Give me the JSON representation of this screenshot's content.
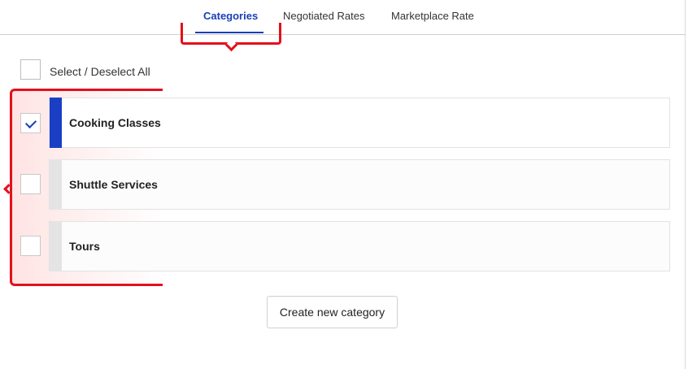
{
  "tabs": [
    {
      "label": "Categories",
      "active": true
    },
    {
      "label": "Negotiated Rates",
      "active": false
    },
    {
      "label": "Marketplace Rate",
      "active": false
    }
  ],
  "select_all": {
    "label": "Select / Deselect All",
    "checked": false
  },
  "categories": [
    {
      "label": "Cooking Classes",
      "checked": true
    },
    {
      "label": "Shuttle Services",
      "checked": false
    },
    {
      "label": "Tours",
      "checked": false
    }
  ],
  "create_button": {
    "label": "Create new category"
  },
  "colors": {
    "accent": "#1a3fb8",
    "selected_bar": "#1b3fc4",
    "annotation_red": "#e3101c"
  }
}
